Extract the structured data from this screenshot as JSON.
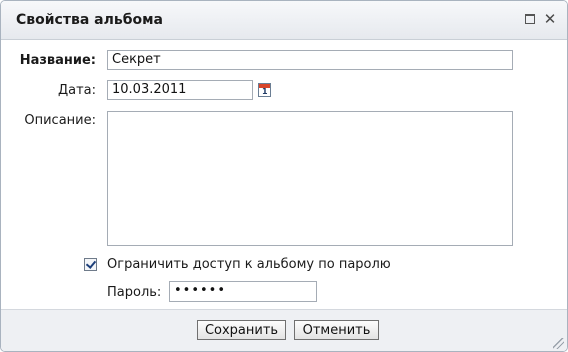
{
  "dialog": {
    "title": "Свойства альбома",
    "maximize_icon": "maximize-icon",
    "close_glyph": "✕"
  },
  "form": {
    "name_label": "Название:",
    "name_value": "Секрет",
    "date_label": "Дата:",
    "date_value": "10.03.2011",
    "calendar_icon_day": "1",
    "description_label": "Описание:",
    "description_value": "",
    "restrict_checkbox_checked": true,
    "restrict_label": "Ограничить доступ к альбому по паролю",
    "password_label": "Пароль:",
    "password_value": "••••••"
  },
  "footer": {
    "save_label": "Сохранить",
    "cancel_label": "Отменить"
  },
  "colors": {
    "titlebar": "#e6e9ee",
    "footer": "#eef0f3",
    "calendar_accent": "#d8452a"
  }
}
